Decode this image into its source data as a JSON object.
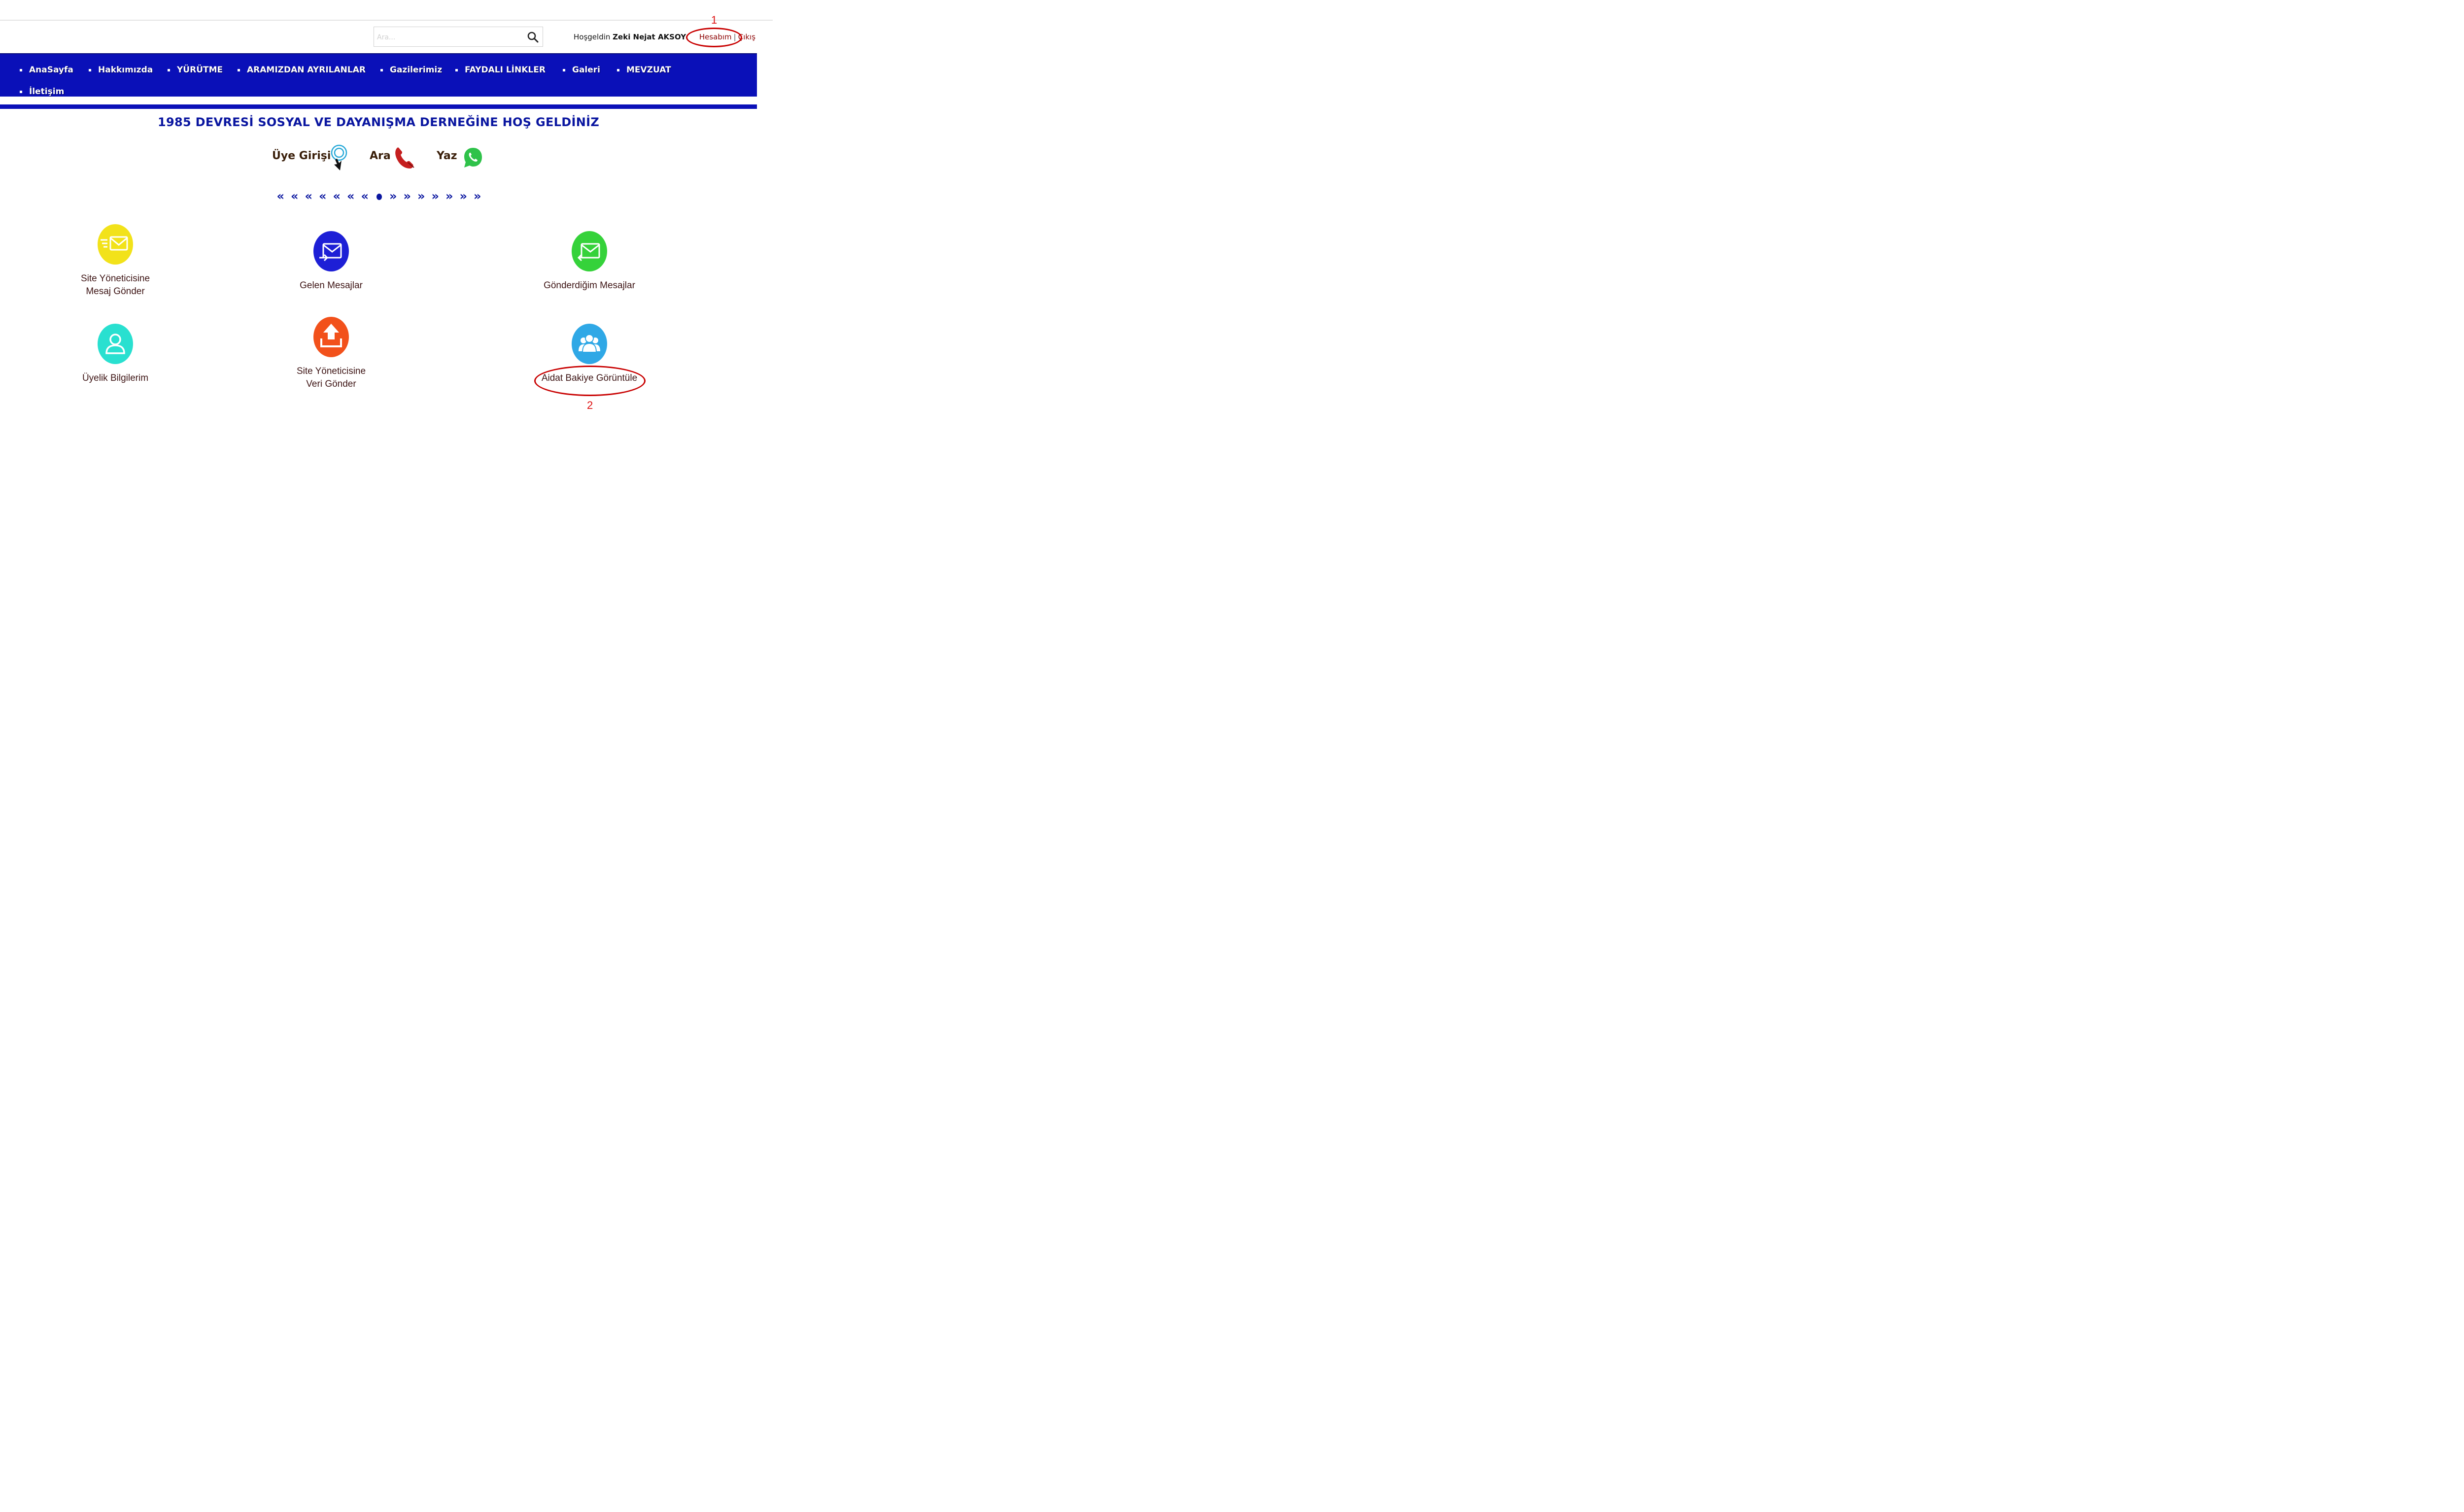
{
  "search": {
    "placeholder": "Ara..."
  },
  "user": {
    "greeting": "Hoşgeldin",
    "name": "Zeki Nejat AKSOY",
    "account_link": "Hesabım",
    "separator": "|",
    "logout_link": "Çıkış"
  },
  "nav": {
    "items": [
      {
        "label": "AnaSayfa"
      },
      {
        "label": "Hakkımızda"
      },
      {
        "label": "YÜRÜTME"
      },
      {
        "label": "ARAMIZDAN AYRILANLAR"
      },
      {
        "label": "Gazilerimiz"
      },
      {
        "label": "FAYDALI LİNKLER"
      },
      {
        "label": "Galeri"
      },
      {
        "label": "MEVZUAT"
      },
      {
        "label": "İletişim"
      }
    ]
  },
  "welcome": {
    "title": "1985 DEVRESİ SOSYAL VE DAYANIŞMA DERNEĞİNE  HOŞ GELDİNİZ"
  },
  "actions": {
    "login": "Üye Girişi",
    "call": "Ara",
    "write": "Yaz"
  },
  "pager": {
    "prev": "«",
    "next": "»"
  },
  "tiles": [
    {
      "line1": "Site Yöneticisine",
      "line2": "Mesaj Gönder",
      "icon": "envelope-send-icon",
      "color": "#f2e21a"
    },
    {
      "line1": "Gelen Mesajlar",
      "line2": "",
      "icon": "envelope-inbox-icon",
      "color": "#1d1fd6"
    },
    {
      "line1": "Gönderdiğim Mesajlar",
      "line2": "",
      "icon": "envelope-sent-icon",
      "color": "#35d23a"
    },
    {
      "line1": "Üyelik Bilgilerim",
      "line2": "",
      "icon": "user-icon",
      "color": "#29e0d0"
    },
    {
      "line1": "Site Yöneticisine",
      "line2": "Veri Gönder",
      "icon": "upload-icon",
      "color": "#f2511b"
    },
    {
      "line1": "Aidat Bakiye Görüntüle",
      "line2": "",
      "icon": "group-icon",
      "color": "#2fa8e6"
    }
  ],
  "annotations": {
    "first": "1",
    "second": "2"
  },
  "colors": {
    "nav": "#0a10b8",
    "accent_red": "#c80000",
    "title_blue": "#0a16a0"
  }
}
